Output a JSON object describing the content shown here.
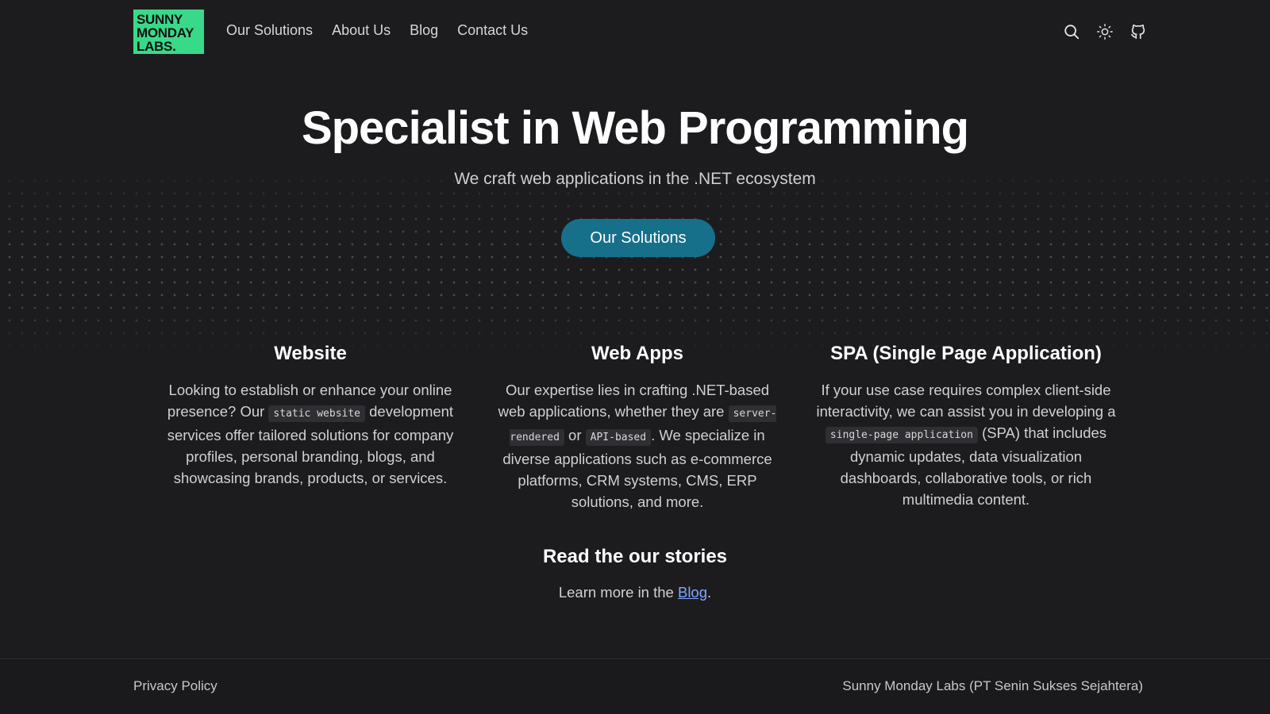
{
  "header": {
    "logo_lines": [
      "SUNNY",
      "MONDAY",
      "LABS."
    ],
    "nav": [
      "Our Solutions",
      "About Us",
      "Blog",
      "Contact Us"
    ],
    "icons": [
      "search-icon",
      "sun-icon",
      "github-icon"
    ]
  },
  "hero": {
    "title": "Specialist in Web Programming",
    "subtitle": "We craft web applications in the .NET ecosystem",
    "button_label": "Our Solutions"
  },
  "services": [
    {
      "title": "Website",
      "text_before": "Looking to establish or enhance your online presence? Our ",
      "code1": "static website",
      "text_after": " development services offer tailored solutions for company profiles, personal branding, blogs, and showcasing brands, products, or services."
    },
    {
      "title": "Web Apps",
      "text_before": "Our expertise lies in crafting .NET-based web applications, whether they are ",
      "code1": "server-rendered",
      "text_mid": " or ",
      "code2": "API-based",
      "text_after": ". We specialize in diverse applications such as e-commerce platforms, CRM systems, CMS, ERP solutions, and more."
    },
    {
      "title": "SPA (Single Page Application)",
      "text_before": "If your use case requires complex client-side interactivity, we can assist you in developing a ",
      "code1": "single-page application",
      "text_after": " (SPA) that includes dynamic updates, data visualization dashboards, collaborative tools, or rich multimedia content."
    }
  ],
  "stories": {
    "title": "Read the our stories",
    "text_before": "Learn more in the ",
    "link": "Blog",
    "text_after": "."
  },
  "footer": {
    "left": "Privacy Policy",
    "right": "Sunny Monday Labs (PT Senin Sukses Sejahtera)"
  },
  "colors": {
    "background": "#1c1c1f",
    "logo_bg": "#39d98a",
    "button_bg": "#17708a",
    "link": "#7ea8ff"
  }
}
